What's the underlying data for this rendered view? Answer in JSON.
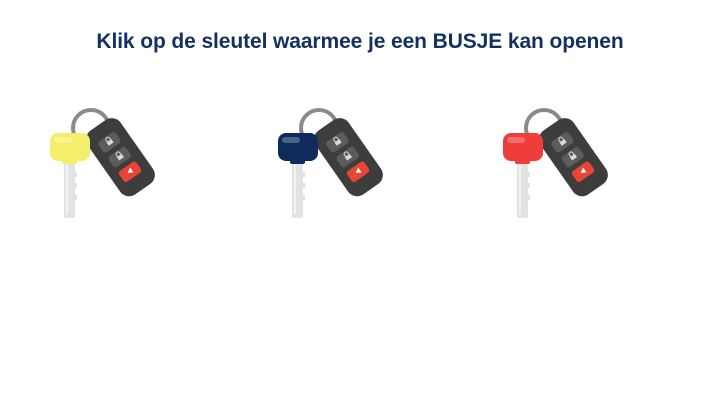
{
  "question": {
    "text": "Klik op de sleutel waarmee je een BUSJE kan openen"
  },
  "keys": [
    {
      "color_name": "yellow",
      "head_color": "#f3ef6b"
    },
    {
      "color_name": "navy",
      "head_color": "#0f2b5e"
    },
    {
      "color_name": "red",
      "head_color": "#ef3d3b"
    }
  ],
  "colors": {
    "title": "#13305e",
    "ring": "#8a8a8a",
    "blade": "#e3e3e3",
    "fob_body": "#3d3d3d",
    "fob_button": "#5c5c5c",
    "fob_alarm": "#e84536"
  }
}
